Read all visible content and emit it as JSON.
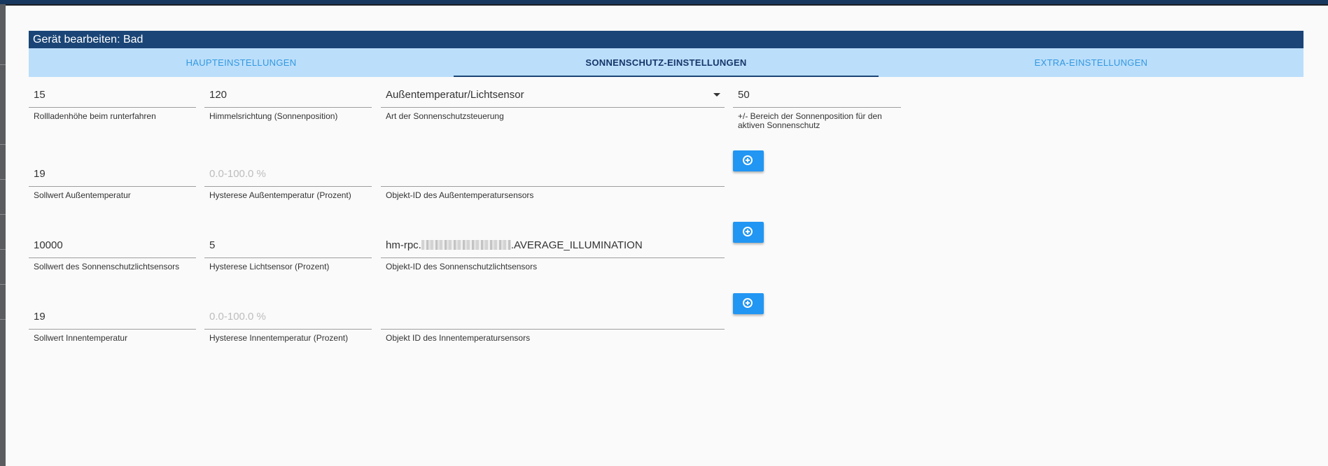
{
  "dialog": {
    "title": "Gerät bearbeiten: Bad"
  },
  "tabs": [
    {
      "label": "HAUPTEINSTELLUNGEN",
      "active": false
    },
    {
      "label": "SONNENSCHUTZ-EINSTELLUNGEN",
      "active": true
    },
    {
      "label": "EXTRA-EINSTELLUNGEN",
      "active": false
    }
  ],
  "fields": {
    "shutter_height": {
      "value": "15",
      "label": "Rollladenhöhe beim runterfahren"
    },
    "sun_direction": {
      "value": "120",
      "label": "Himmelsrichtung (Sonnenposition)"
    },
    "control_type": {
      "value": "Außentemperatur/Lichtsensor",
      "label": "Art der Sonnenschutzsteuerung"
    },
    "sun_range": {
      "value": "50",
      "label": "+/- Bereich der Sonnenposition für den aktiven Sonnenschutz"
    },
    "outside_temp_setpoint": {
      "value": "19",
      "label": "Sollwert Außentemperatur"
    },
    "outside_temp_hysteresis": {
      "placeholder": "0.0-100.0 %",
      "label": "Hysterese Außentemperatur (Prozent)"
    },
    "outside_temp_sensor_id": {
      "value": "",
      "label": "Objekt-ID des Außentemperatursensors"
    },
    "light_setpoint": {
      "value": "10000",
      "label": "Sollwert des Sonnenschutzlichtsensors"
    },
    "light_hysteresis": {
      "value": "5",
      "label": "Hysterese Lichtsensor (Prozent)"
    },
    "light_sensor_id": {
      "prefix": "hm-rpc.",
      "suffix": ".AVERAGE_ILLUMINATION",
      "label": "Objekt-ID des Sonnenschutzlichtsensors"
    },
    "inside_temp_setpoint": {
      "value": "19",
      "label": "Sollwert Innentemperatur"
    },
    "inside_temp_hysteresis": {
      "placeholder": "0.0-100.0 %",
      "label": "Hysterese Innentemperatur (Prozent)"
    },
    "inside_temp_sensor_id": {
      "value": "",
      "label": "Objekt ID des Innentemperatursensors"
    }
  },
  "buttons": {
    "add_icon": "plus-circle-icon"
  },
  "colors": {
    "title_bar": "#1a4576",
    "tab_bar": "#bbdefb",
    "button": "#2196f3"
  }
}
